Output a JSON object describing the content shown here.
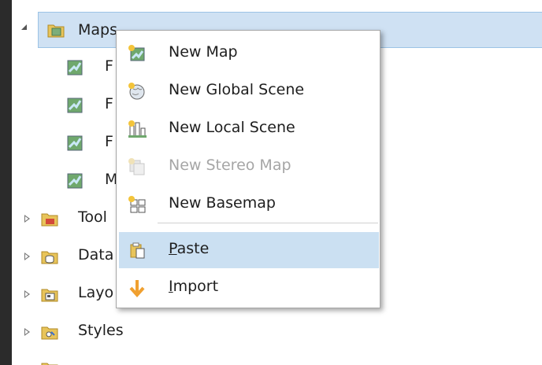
{
  "tree": {
    "maps_label": "Maps",
    "map_items": [
      {
        "label": "F"
      },
      {
        "label": "F"
      },
      {
        "label": "F"
      },
      {
        "label": "M"
      }
    ],
    "folders": [
      {
        "label": "Tool"
      },
      {
        "label": "Data"
      },
      {
        "label": "Layo"
      },
      {
        "label": "Styles"
      }
    ]
  },
  "menu": {
    "new_map": "New Map",
    "new_global_scene": "New Global Scene",
    "new_local_scene": "New Local Scene",
    "new_stereo_map": "New Stereo Map",
    "new_basemap": "New Basemap",
    "paste_first": "P",
    "paste_rest": "aste",
    "import_first": "I",
    "import_rest": "mport"
  },
  "colors": {
    "selection": "#cfe1f3",
    "menu_highlight": "#cbe0f2",
    "disabled_text": "#a6a6a6",
    "import_arrow": "#f0a030"
  }
}
